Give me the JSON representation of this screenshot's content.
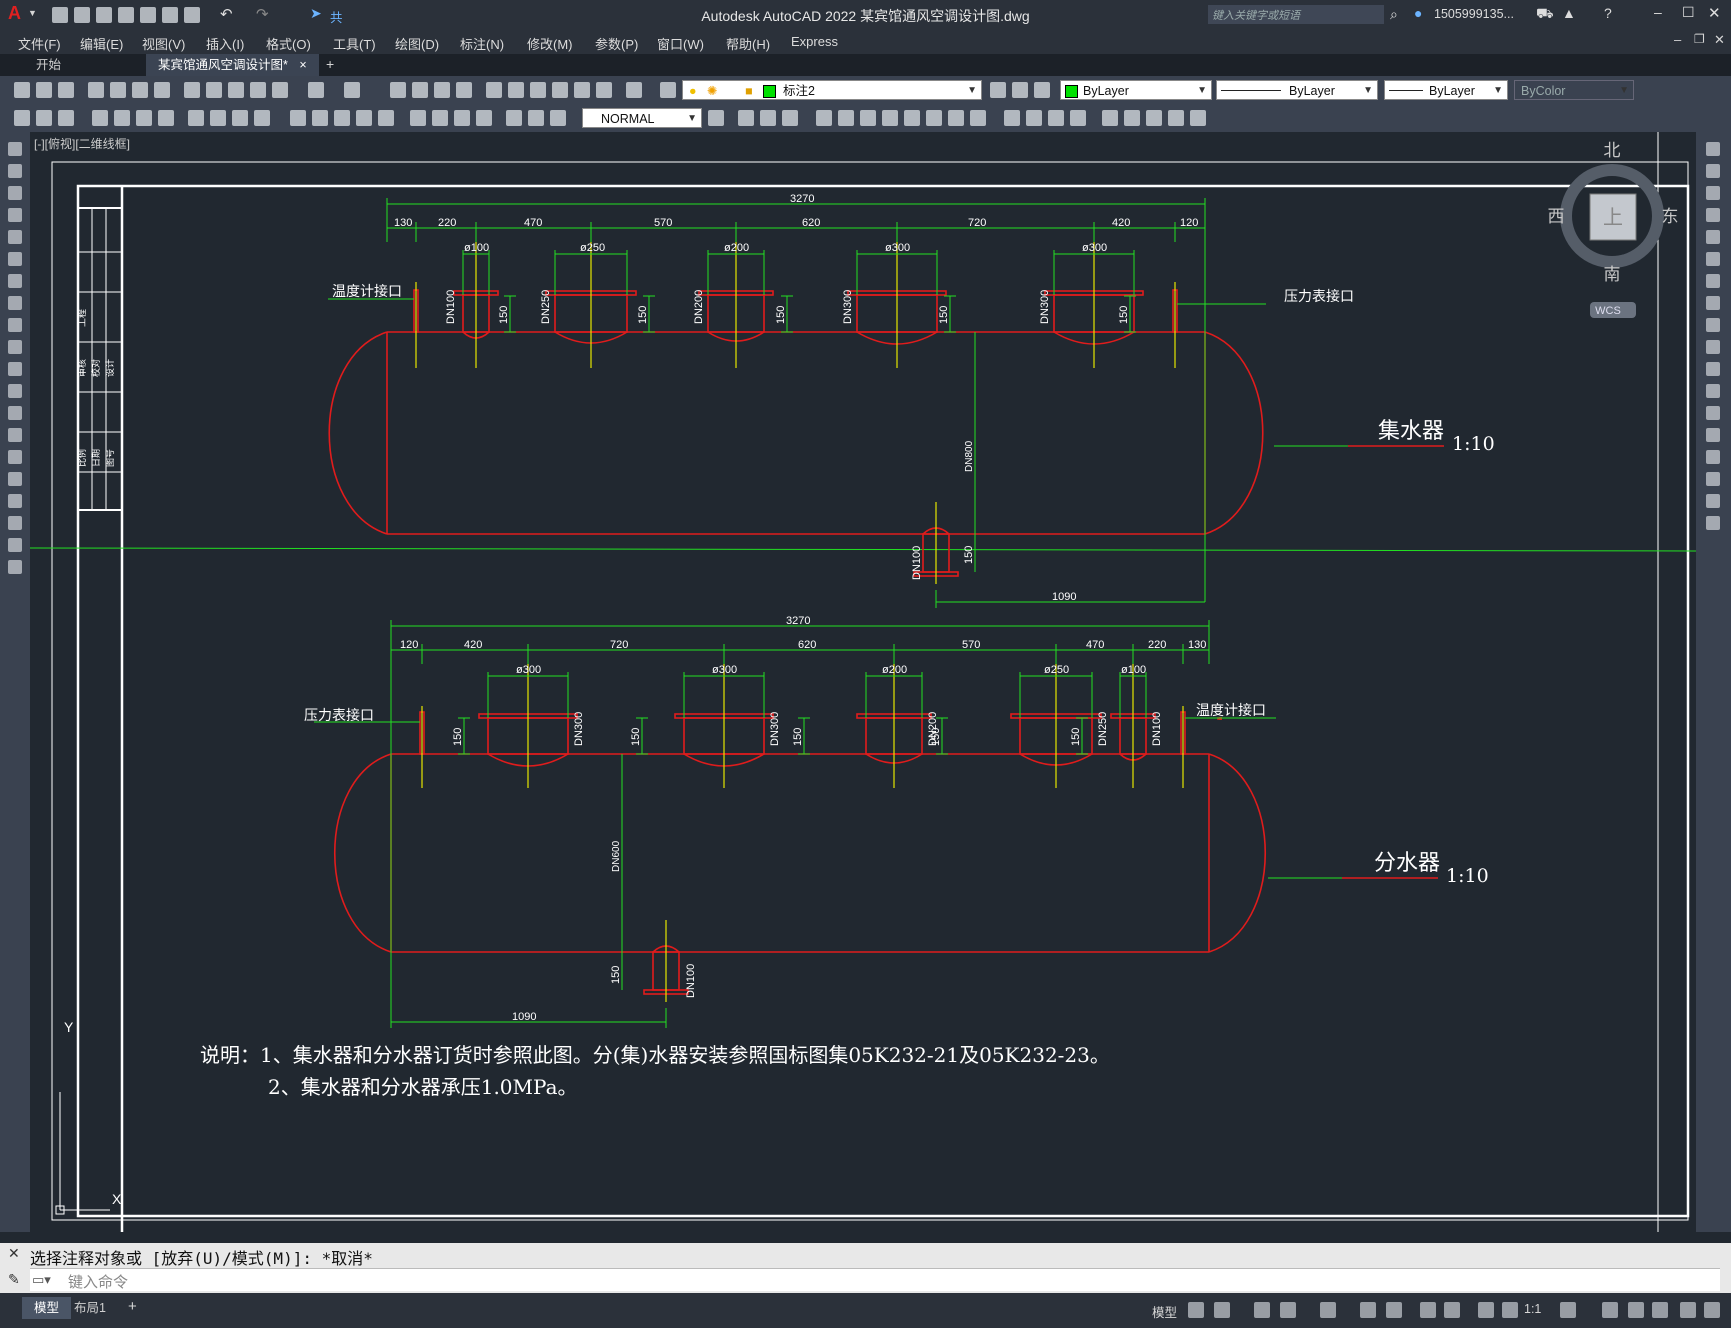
{
  "app": {
    "title": "Autodesk AutoCAD 2022    某宾馆通风空调设计图.dwg",
    "share_label": "共享",
    "search_placeholder": "键入关键字或短语",
    "user": "1505999135...",
    "logo": "A"
  },
  "menu": [
    "文件(F)",
    "编辑(E)",
    "视图(V)",
    "插入(I)",
    "格式(O)",
    "工具(T)",
    "绘图(D)",
    "标注(N)",
    "修改(M)",
    "参数(P)",
    "窗口(W)",
    "帮助(H)",
    "Express"
  ],
  "tabs": {
    "start": "开始",
    "doc": "某宾馆通风空调设计图*",
    "close": "×",
    "add": "+"
  },
  "toolbar": {
    "layer": "标注2",
    "color": "ByLayer",
    "linetype": "ByLayer",
    "lineweight": "ByLayer",
    "plotstyle": "ByColor",
    "dimstyle": "NORMAL"
  },
  "viewport_label": "[-][俯视][二维线框]",
  "viewcube": {
    "north": "北",
    "south": "南",
    "west": "西",
    "east": "东",
    "top": "上",
    "wcs": "WCS"
  },
  "drawing": {
    "upper": {
      "title": "集水器",
      "scale": "1:10",
      "total": "3270",
      "segments": [
        "130",
        "220",
        "470",
        "570",
        "620",
        "720",
        "420",
        "120"
      ],
      "diameters": [
        "ø100",
        "ø250",
        "ø200",
        "ø300",
        "ø300"
      ],
      "dn": [
        "DN100",
        "DN250",
        "DN200",
        "DN300",
        "DN300"
      ],
      "h150": "150",
      "left_port": "温度计接口",
      "right_port": "压力表接口",
      "body_dn": "DN800",
      "bottom_dn": "DN100",
      "bottom_h": "150",
      "offset": "1090"
    },
    "lower": {
      "title": "分水器",
      "scale": "1:10",
      "total": "3270",
      "segments": [
        "120",
        "420",
        "720",
        "620",
        "570",
        "470",
        "220",
        "130"
      ],
      "diameters": [
        "ø300",
        "ø300",
        "ø200",
        "ø250",
        "ø100"
      ],
      "dn": [
        "DN300",
        "DN300",
        "DN200",
        "DN250",
        "DN100"
      ],
      "h150": "150",
      "left_port": "压力表接口",
      "right_port": "温度计接口",
      "body_dn": "DN600",
      "bottom_dn": "DN100",
      "bottom_h": "150",
      "offset": "1090"
    },
    "notes": [
      "说明：1、集水器和分水器订货时参照此图。分(集)水器安装参照国标图集05K232-21及05K232-23。",
      "2、集水器和分水器承压1.0MPa。"
    ],
    "title_block": [
      "工程",
      "审核",
      "校对",
      "设计",
      "比例",
      "日期",
      "图号"
    ],
    "ucs": {
      "x": "X",
      "y": "Y"
    }
  },
  "command": {
    "history": "选择注释对象或 [放弃(U)/模式(M)]: *取消*",
    "placeholder": "键入命令"
  },
  "status": {
    "model_tab": "模型",
    "layout_tab": "布局1",
    "model_btn": "模型",
    "scale": "1:1"
  },
  "colors": {
    "vessel": "#e01c1c",
    "dim": "#22e022",
    "axis": "#e6e600",
    "frame": "#ffffff",
    "bg": "#212830"
  }
}
